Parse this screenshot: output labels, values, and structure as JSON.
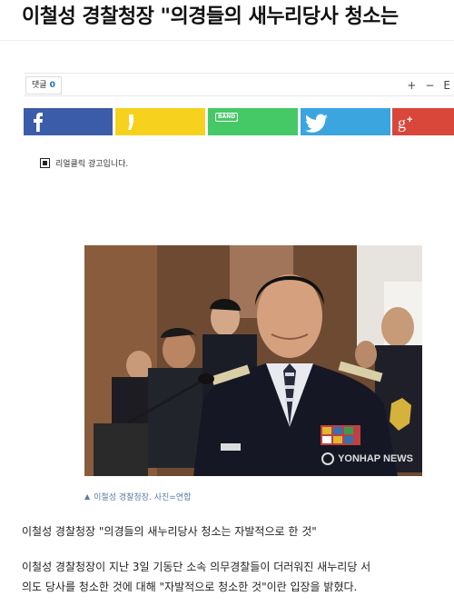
{
  "article": {
    "headline": "이철성 경찰청장 \"의경들의 새누리당사 청소는",
    "comment_label": "댓글",
    "comment_count": "0",
    "font_tools": [
      "+",
      "−",
      "E"
    ],
    "share": {
      "band_label": "BAND"
    },
    "ad_text": "리얼클릭 광고입니다.",
    "photo": {
      "watermark": "YONHAP NEWS"
    },
    "caption": "이철성 경찰청장. 사진=연합",
    "subhead": "이철성 경찰청장 \"의경들의 새누리당사 청소는 자발적으로 한 것\"",
    "body_lines": [
      "이철성 경찰청장이 지난 3일 기동단 소속 의무경찰들이 더러워진 새누리당 서",
      "의도 당사를 청소한 것에 대해 \"자발적으로 청소한 것\"이란 입장을 밝혔다."
    ]
  },
  "colors": {
    "facebook": "#3b5ca8",
    "kakaostory": "#f6d21f",
    "band": "#45c866",
    "twitter": "#3ba5e0",
    "googleplus": "#d9473b",
    "comment_count": "#1a6cd1",
    "caption": "#5a7aa6"
  },
  "icons": [
    "facebook-icon",
    "kakaostory-icon",
    "band-icon",
    "twitter-icon",
    "google-plus-icon",
    "ad-info-icon"
  ]
}
